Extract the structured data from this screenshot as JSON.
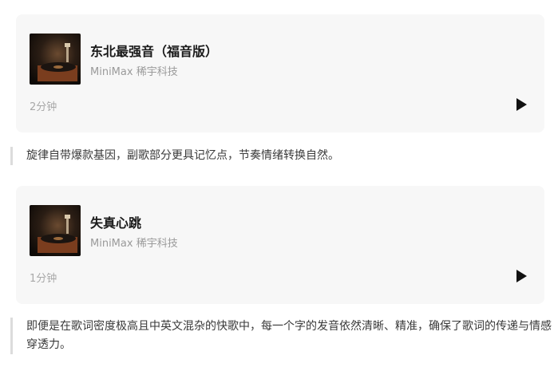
{
  "songs": [
    {
      "title": "东北最强音（福音版）",
      "artist": "MiniMax 稀宇科技",
      "duration": "2分钟",
      "cover_icon": "vinyl-record-player-icon",
      "play_icon": "play-icon"
    },
    {
      "title": "失真心跳",
      "artist": "MiniMax 稀宇科技",
      "duration": "1分钟",
      "cover_icon": "vinyl-record-player-icon",
      "play_icon": "play-icon"
    }
  ],
  "comments": [
    "旋律自带爆款基因，副歌部分更具记忆点，节奏情绪转换自然。",
    "即便是在歌词密度极高且中英文混杂的快歌中，每一个字的发音依然清晰、精准，确保了歌词的传递与情感穿透力。"
  ],
  "colors": {
    "card_bg": "#f7f7f7",
    "quote_bar": "#dcdcdc",
    "muted_text": "#9a9a9a"
  }
}
